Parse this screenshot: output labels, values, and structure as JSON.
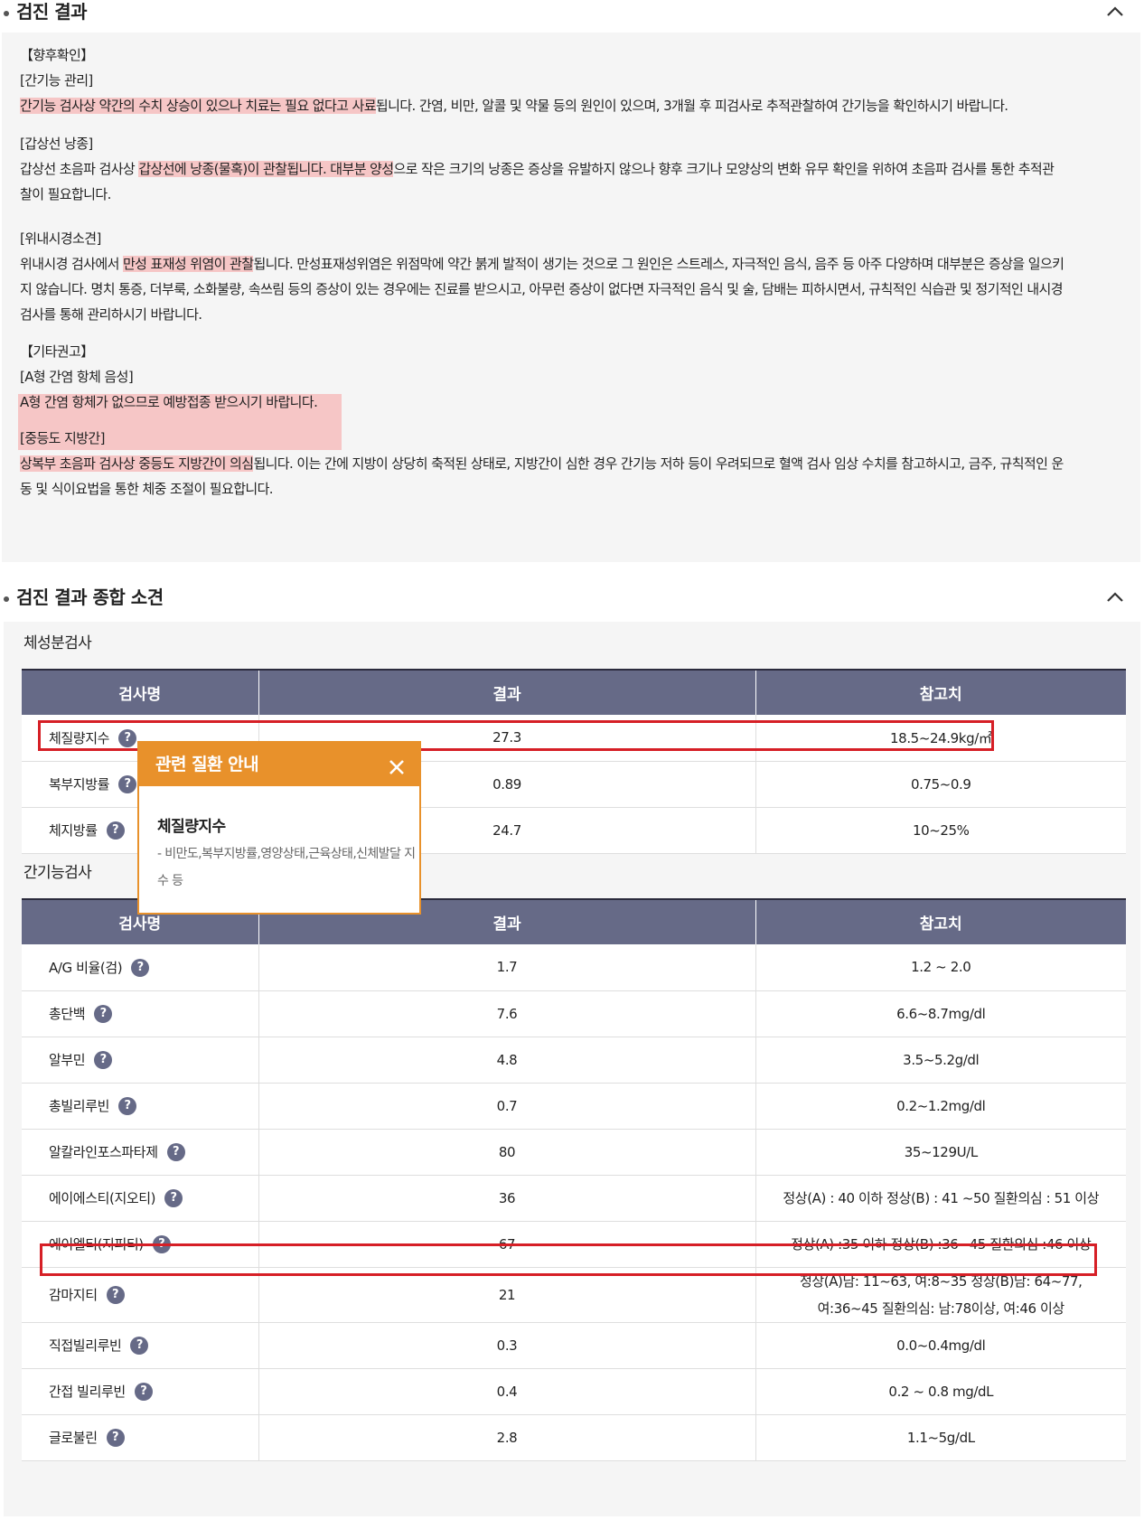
{
  "section1": {
    "title": "검진 결과",
    "p": {
      "h1": "【향후확인】",
      "liver_title": "[간기능 관리]",
      "liver_hl": "간기능 검사상 약간의 수치 상승이 있으나 치료는 필요 없다고 사료",
      "liver_rest": "됩니다. 간염, 비만, 알콜 및 약물 등의 원인이 있으며, 3개월 후 피검사로 추적관찰하여 간기능을 확인하시기 바랍니다.",
      "thyroid_title": "[갑상선 낭종]",
      "thyroid_a": "갑상선 초음파 검사상 ",
      "thyroid_hl": "갑상선에 낭종(물혹)이 관찰됩니다. 대부분 양성",
      "thyroid_b": "으로 작은 크기의 낭종은 증상을 유발하지 않으나 향후 크기나 모양상의 변화 유무 확인을 위하여 초음파 검사를 통한 추적관",
      "thyroid_c": "찰이 필요합니다.",
      "gastro_title": "[위내시경소견]",
      "gastro_a": "위내시경 검사에서 ",
      "gastro_hl": "만성 표재성 위염이 관찰",
      "gastro_b": "됩니다. 만성표재성위염은 위점막에 약간 붉게 발적이 생기는 것으로 그 원인은 스트레스, 자극적인 음식, 음주 등 아주 다양하며 대부분은 증상을 일으키",
      "gastro_c": "지 않습니다. 명치 통증, 더부룩, 소화불량, 속쓰림 등의 증상이 있는 경우에는 진료를 받으시고, 아무런 증상이 없다면 자극적인 음식 및 술, 담배는 피하시면서, 규칙적인 식습관 및 정기적인 내시경",
      "gastro_d": "검사를 통해 관리하시기 바랍니다.",
      "h2": "【기타권고】",
      "hepa_title": "[A형 간염 항체 음성]",
      "hepa_text": "A형 간염 항체가 없으므로 예방접종 받으시기 바랍니다.",
      "fatty_title": "[중등도 지방간]",
      "fatty_hl": "상복부 초음파 검사상 중등도 지방간이 의심",
      "fatty_a": "됩니다. 이는 간에 지방이 상당히 축적된 상태로, 지방간이 심한 경우 간기능 저하 등이 우려되므로 혈액 검사 임상 수치를 참고하시고, 금주, 규칙적인 운",
      "fatty_b": "동 및 식이요법을 통한 체중 조절이 필요합니다."
    }
  },
  "section2": {
    "title": "검진 결과 종합 소견",
    "headers": [
      "검사명",
      "결과",
      "참고치"
    ],
    "body_title": "체성분검사",
    "body_rows": [
      {
        "name": "체질량지수",
        "result": "27.3",
        "ref": "18.5~24.9kg/㎡"
      },
      {
        "name": "복부지방률",
        "result": "0.89",
        "ref": "0.75~0.9"
      },
      {
        "name": "체지방률",
        "result": "24.7",
        "ref": "10~25%"
      }
    ],
    "liver_title": "간기능검사",
    "liver_rows": [
      {
        "name": "A/G 비율(검)",
        "result": "1.7",
        "ref": "1.2 ~ 2.0"
      },
      {
        "name": "총단백",
        "result": "7.6",
        "ref": "6.6~8.7mg/dl"
      },
      {
        "name": "알부민",
        "result": "4.8",
        "ref": "3.5~5.2g/dl"
      },
      {
        "name": "총빌리루빈",
        "result": "0.7",
        "ref": "0.2~1.2mg/dl"
      },
      {
        "name": "알칼라인포스파타제",
        "result": "80",
        "ref": "35~129U/L"
      },
      {
        "name": "에이에스티(지오티)",
        "result": "36",
        "ref": "정상(A) : 40 이하 정상(B) : 41 ~50 질환의심 : 51 이상"
      },
      {
        "name": "에이엘티(지피티)",
        "result": "67",
        "ref": "정상(A) :35 이하 정상(B) :36~45 질환의심 :46 이상"
      },
      {
        "name": "감마지티",
        "result": "21",
        "ref1": "정상(A)남: 11~63, 여:8~35 정상(B)남: 64~77,",
        "ref2": "여:36~45 질환의심: 남:78이상, 여:46 이상"
      },
      {
        "name": "직접빌리루빈",
        "result": "0.3",
        "ref": "0.0~0.4mg/dl"
      },
      {
        "name": "간접 빌리루빈",
        "result": "0.4",
        "ref": "0.2 ~ 0.8 mg/dL"
      },
      {
        "name": "글로불린",
        "result": "2.8",
        "ref": "1.1~5g/dL"
      }
    ],
    "help_icon": "?"
  },
  "popup": {
    "title": "관련 질환 안내",
    "close_icon": "close-icon",
    "item_title": "체질량지수",
    "item_desc": "- 비만도,복부지방률,영양상태,근육상태,신체발달 지수 등"
  },
  "colors": {
    "table_header": "#666a87",
    "highlight": "#f6c6c6",
    "popup_accent": "#e8912b",
    "emphasis_box": "#d61f26"
  }
}
